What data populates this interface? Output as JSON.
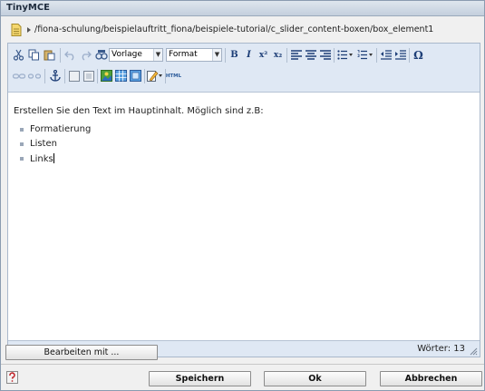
{
  "window": {
    "title": "TinyMCE"
  },
  "path": {
    "text": "/fiona-schulung/beispielauftritt_fiona/beispiele-tutorial/c_slider_content-boxen/box_element1"
  },
  "toolbar": {
    "style_select": "Vorlage",
    "format_select": "Format",
    "bold_label": "B",
    "italic_label": "I",
    "superscript_label": "x²",
    "subscript_label": "x₂",
    "special_char_label": "Ω",
    "html_label": "HTML"
  },
  "editor": {
    "intro": "Erstellen Sie den Text im Hauptinhalt. Möglich sind z.B:",
    "items": [
      "Formatierung",
      "Listen",
      "Links"
    ]
  },
  "status": {
    "word_count": "Wörter: 13"
  },
  "buttons": {
    "edit_with": "Bearbeiten mit ...",
    "save": "Speichern",
    "ok": "Ok",
    "cancel": "Abbrechen"
  }
}
